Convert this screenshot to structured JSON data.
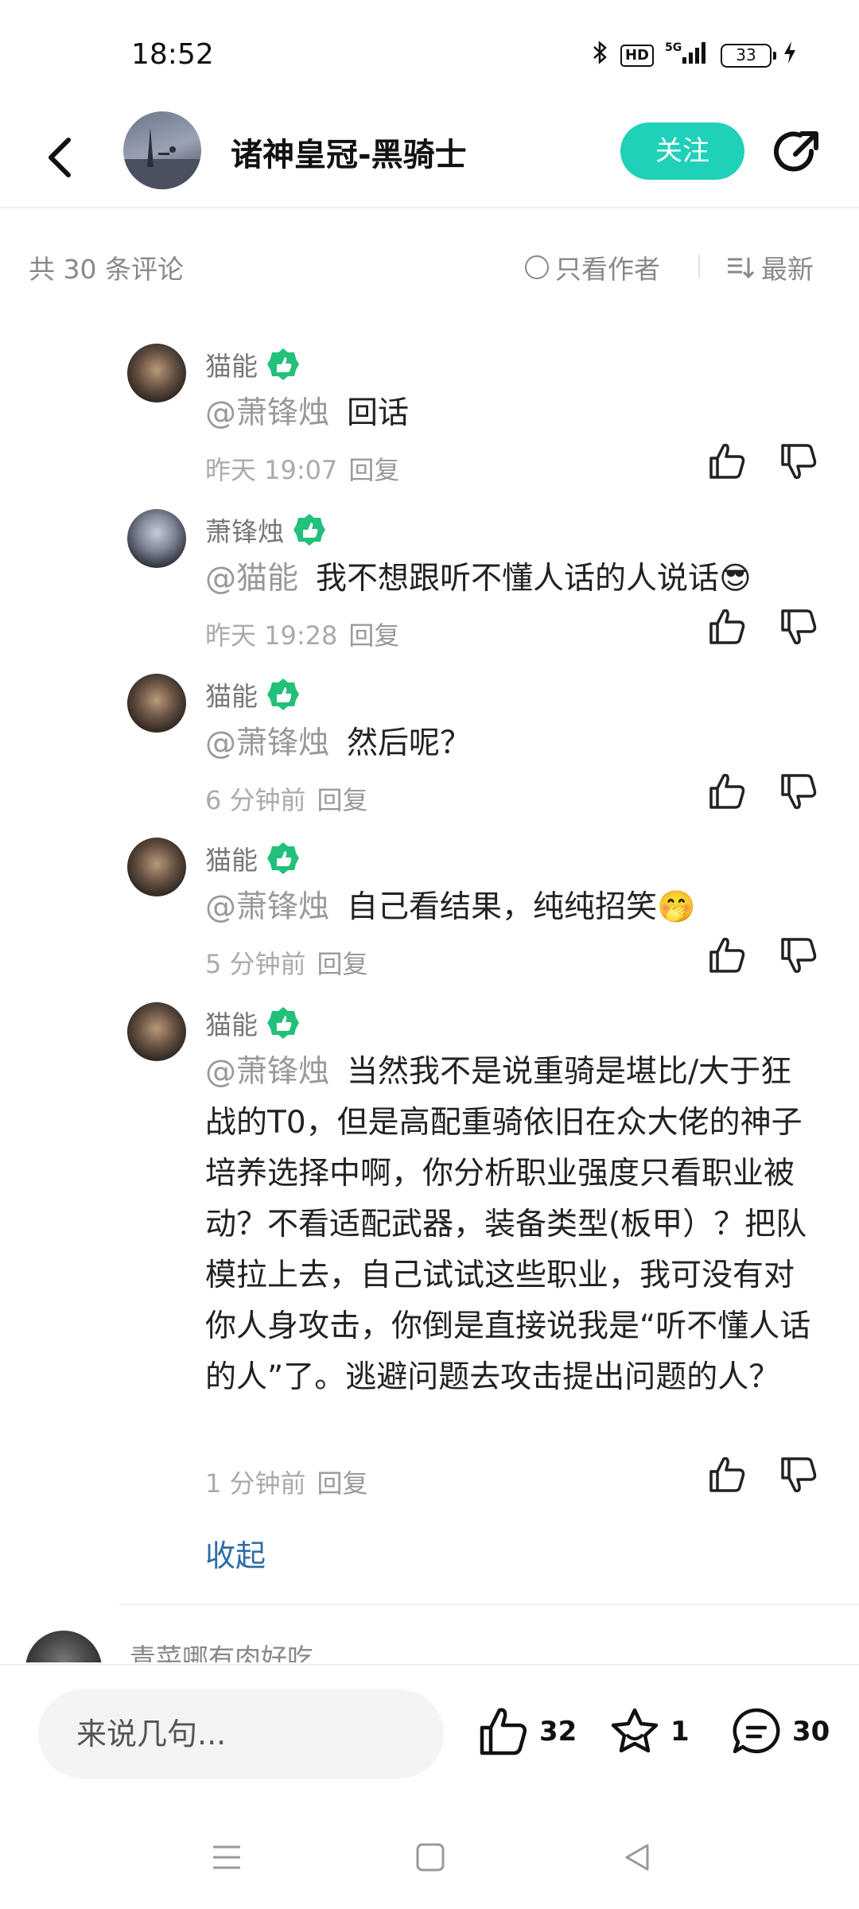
{
  "status_bar": {
    "time": "18:52",
    "battery": "33",
    "icons": [
      "bluetooth-icon",
      "hd-icon",
      "5g-signal-icon",
      "battery-icon",
      "charging-icon"
    ],
    "hd_label": "HD",
    "network_label": "5G"
  },
  "header": {
    "title": "诸神皇冠-黑骑士",
    "follow_label": "关注"
  },
  "filter": {
    "count_label": "共 30 条评论",
    "only_author_label": "只看作者",
    "sort_label": "最新"
  },
  "comments": [
    {
      "author": "猫能",
      "mention": "@萧锋烛",
      "text": "回话",
      "time": "昨天 19:07",
      "reply_label": "回复"
    },
    {
      "author": "萧锋烛",
      "mention": "@猫能",
      "text": "我不想跟听不懂人话的人说话😎",
      "time": "昨天 19:28",
      "reply_label": "回复"
    },
    {
      "author": "猫能",
      "mention": "@萧锋烛",
      "text": "然后呢？",
      "time": "6 分钟前",
      "reply_label": "回复"
    },
    {
      "author": "猫能",
      "mention": "@萧锋烛",
      "text": "自己看结果，纯纯招笑🤭",
      "time": "5 分钟前",
      "reply_label": "回复"
    },
    {
      "author": "猫能",
      "mention": "@萧锋烛",
      "text": "当然我不是说重骑是堪比/大于狂战的T0，但是高配重骑依旧在众大佬的神子培养选择中啊，你分析职业强度只看职业被动？不看适配武器，装备类型(板甲）？把队模拉上去，自己试试这些职业，我可没有对你人身攻击，你倒是直接说我是“听不懂人话的人”了。逃避问题去攻击提出问题的人？",
      "time": "1 分钟前",
      "reply_label": "回复"
    }
  ],
  "collapse_label": "收起",
  "next_comment_author": "青菜哪有肉好吃",
  "bottom_bar": {
    "input_placeholder": "来说几句...",
    "like_count": "32",
    "favorite_count": "1",
    "comment_count": "30"
  },
  "colors": {
    "accent": "#1fd1b8",
    "badge_green": "#22c07a",
    "link_blue": "#2e6da4"
  }
}
